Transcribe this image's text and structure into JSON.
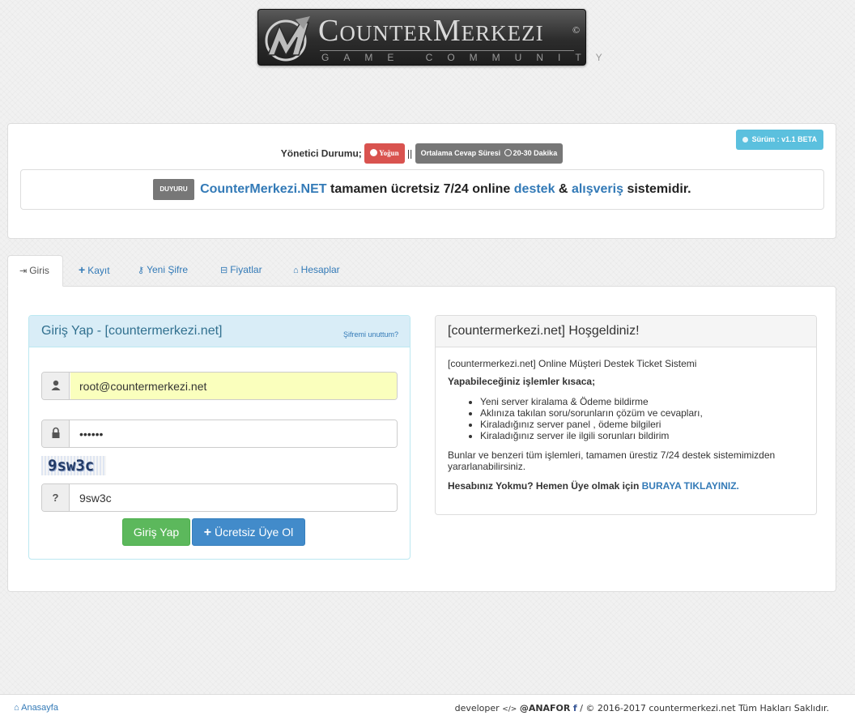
{
  "logo": {
    "title": "CounterMerkezi",
    "copyright": "©",
    "subtitle": "GAME COMMUNITY"
  },
  "status": {
    "version_badge": "Sürüm : v1.1 BETA",
    "admin_label": "Yönetici Durumu;",
    "admin_state": "Yoğun",
    "separator": "||",
    "response_time": "Ortalama Cevap Süresi",
    "response_value": "20-30 Dakika"
  },
  "announcement": {
    "label": "DUYURU",
    "site": "CounterMerkezi.NET",
    "text1": "tamamen ücretsiz 7/24 online",
    "link1": "destek",
    "amp": "&",
    "link2": "alışveriş",
    "text2": "sistemidir."
  },
  "tabs": [
    {
      "label": "Giris",
      "icon": "sign-in-icon"
    },
    {
      "label": "Kayıt",
      "icon": "plus-icon"
    },
    {
      "label": "Yeni Şifre",
      "icon": "key-icon"
    },
    {
      "label": "Fiyatlar",
      "icon": "basket-icon"
    },
    {
      "label": "Hesaplar",
      "icon": "bank-icon"
    }
  ],
  "login": {
    "title": "Giriş Yap - [countermerkezi.net]",
    "forgot": "Şifremi unuttum?",
    "email_value": "root@countermerkezi.net",
    "password_value": "••••••",
    "captcha_image_text": "9sw3c",
    "captcha_value": "9sw3c",
    "captcha_addon": "?",
    "login_button": "Giriş Yap",
    "register_button": "Ücretsiz Üye Ol"
  },
  "welcome": {
    "title": "[countermerkezi.net] Hoşgeldiniz!",
    "intro": "[countermerkezi.net] Online Müşteri Destek Ticket Sistemi",
    "subtitle": "Yapabileceğiniz işlemler kısaca;",
    "items": [
      "Yeni server kiralama & Ödeme bildirme",
      "Aklınıza takılan soru/sorunların çözüm ve cevapları,",
      "Kiraladığınız server panel , ödeme bilgileri",
      "Kiraladığınız server ile ilgili sorunları bildirim"
    ],
    "description": "Bunlar ve benzeri tüm işlemleri, tamamen ürestiz 7/24 destek sistemimizden yararlanabilirsiniz.",
    "cta_text": "Hesabınız Yokmu? Hemen Üye olmak için",
    "cta_link": "BURAYA TIKLAYINIZ."
  },
  "footer": {
    "home": "Anasayfa",
    "developer": "developer",
    "code_glyph": "</>",
    "author": "@ANAFOR",
    "facebook": "f",
    "rights": "/ © 2016-2017 countermerkezi.net Tüm Hakları Saklıdır."
  },
  "colors": {
    "primary": "#337ab7",
    "success": "#5cb85c",
    "danger": "#d9534f",
    "info": "#5bc0de",
    "muted": "#777777"
  }
}
